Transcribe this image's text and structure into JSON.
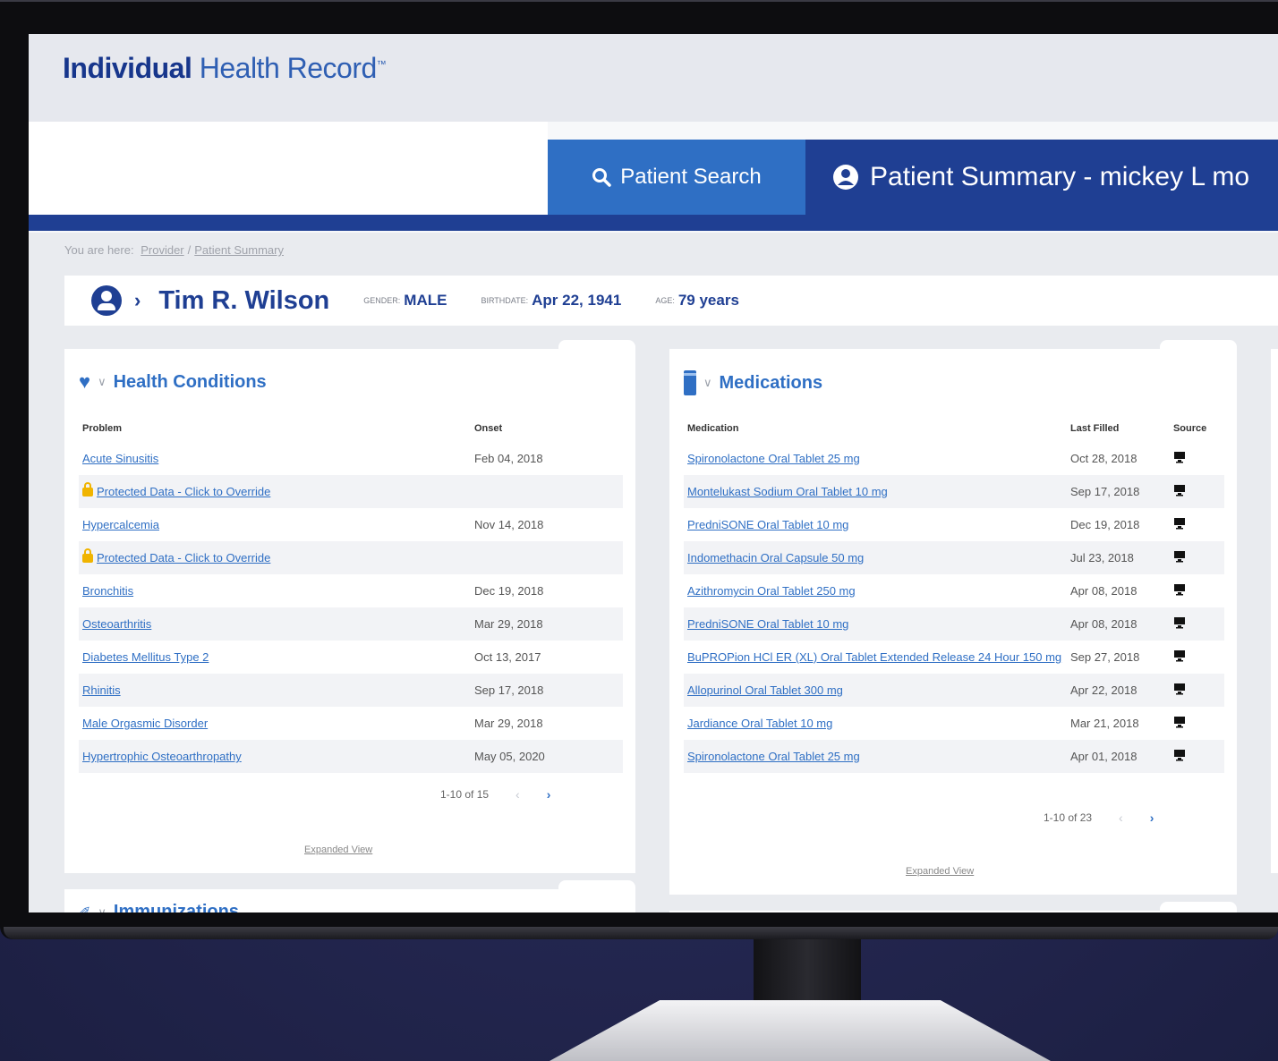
{
  "app": {
    "title_bold": "Individual",
    "title_rest": "Health Record",
    "trademark": "™"
  },
  "nav": {
    "search_tab": "Patient Search",
    "summary_tab": "Patient Summary - mickey L mo"
  },
  "breadcrumb": {
    "prefix": "You are here:",
    "items": [
      "Provider",
      "Patient Summary"
    ],
    "separator": "/"
  },
  "patient": {
    "name": "Tim R. Wilson",
    "gender_label": "GENDER:",
    "gender": "MALE",
    "birthdate_label": "BIRTHDATE:",
    "birthdate": "Apr 22, 1941",
    "age_label": "AGE:",
    "age": "79 years"
  },
  "conditions": {
    "title": "Health Conditions",
    "columns": [
      "Problem",
      "Onset"
    ],
    "rows": [
      {
        "name": "Acute Sinusitis",
        "onset": "Feb 04, 2018",
        "protected": false
      },
      {
        "name": "Protected Data - Click to Override",
        "onset": "",
        "protected": true
      },
      {
        "name": "Hypercalcemia",
        "onset": "Nov 14, 2018",
        "protected": false
      },
      {
        "name": "Protected Data - Click to Override",
        "onset": "",
        "protected": true
      },
      {
        "name": "Bronchitis",
        "onset": "Dec 19, 2018",
        "protected": false
      },
      {
        "name": "Osteoarthritis",
        "onset": "Mar 29, 2018",
        "protected": false
      },
      {
        "name": "Diabetes Mellitus Type 2",
        "onset": "Oct 13, 2017",
        "protected": false
      },
      {
        "name": "Rhinitis",
        "onset": "Sep 17, 2018",
        "protected": false
      },
      {
        "name": "Male Orgasmic Disorder",
        "onset": "Mar 29, 2018",
        "protected": false
      },
      {
        "name": "Hypertrophic Osteoarthropathy",
        "onset": "May 05, 2020",
        "protected": false
      }
    ],
    "pager": "1-10 of 15",
    "expanded_view": "Expanded View"
  },
  "medications": {
    "title": "Medications",
    "columns": [
      "Medication",
      "Last Filled",
      "Source"
    ],
    "rows": [
      {
        "name": "Spironolactone Oral Tablet 25 mg",
        "filled": "Oct 28, 2018"
      },
      {
        "name": "Montelukast Sodium Oral Tablet 10 mg",
        "filled": "Sep 17, 2018"
      },
      {
        "name": "PredniSONE Oral Tablet 10 mg",
        "filled": "Dec 19, 2018"
      },
      {
        "name": "Indomethacin Oral Capsule 50 mg",
        "filled": "Jul 23, 2018"
      },
      {
        "name": "Azithromycin Oral Tablet 250 mg",
        "filled": "Apr 08, 2018"
      },
      {
        "name": "PredniSONE Oral Tablet 10 mg",
        "filled": "Apr 08, 2018"
      },
      {
        "name": "BuPROPion HCl ER (XL) Oral Tablet Extended Release 24 Hour 150 mg",
        "filled": "Sep 27, 2018"
      },
      {
        "name": "Allopurinol Oral Tablet 300 mg",
        "filled": "Apr 22, 2018"
      },
      {
        "name": "Jardiance Oral Tablet 10 mg",
        "filled": "Mar 21, 2018"
      },
      {
        "name": "Spironolactone Oral Tablet 25 mg",
        "filled": "Apr 01, 2018"
      }
    ],
    "pager": "1-10 of 23",
    "expanded_view": "Expanded View"
  },
  "next_card": {
    "title": "Immunizations"
  },
  "icons": {
    "search": "search-icon",
    "user": "user-circle-icon",
    "chevron": "chevron-right-icon",
    "heart": "heart-icon",
    "pill": "pill-bottle-icon",
    "lock": "lock-icon",
    "source": "monitor-icon"
  },
  "colors": {
    "brand_dark": "#1f3f93",
    "brand_blue": "#2f6fc4",
    "lock": "#f0b400"
  }
}
